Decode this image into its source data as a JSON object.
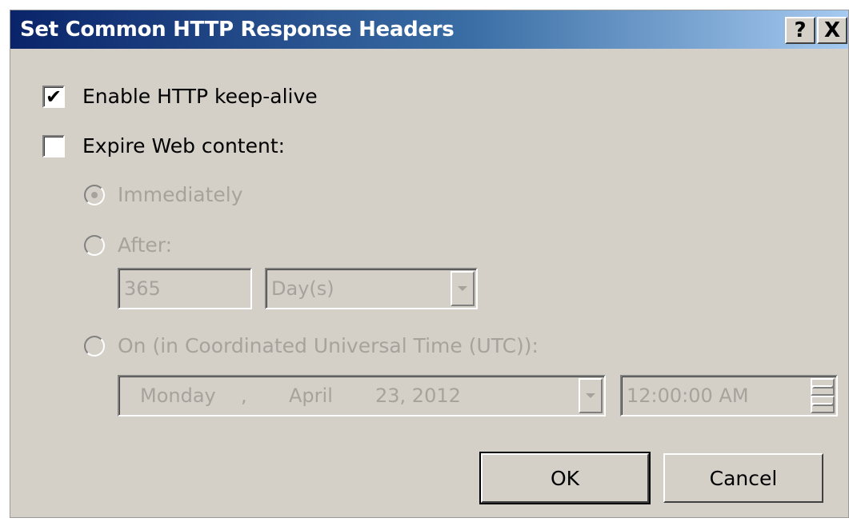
{
  "dialog": {
    "title": "Set Common HTTP Response Headers",
    "help_label": "?",
    "close_label": "X"
  },
  "keepalive": {
    "label": "Enable HTTP keep-alive",
    "checked": true,
    "check_mark": "✔"
  },
  "expire": {
    "label": "Expire Web content:",
    "checked": false
  },
  "immediately": {
    "label": "Immediately",
    "selected": true
  },
  "after": {
    "label": "After:",
    "value": "365",
    "unit": "Day(s)"
  },
  "on": {
    "label": "On (in Coordinated Universal Time (UTC)):",
    "weekday": "Monday",
    "sep": ",",
    "month": "April",
    "day_year": "23, 2012",
    "time": "12:00:00 AM"
  },
  "buttons": {
    "ok": "OK",
    "cancel": "Cancel"
  },
  "icons": {
    "help": "question-icon",
    "close": "close-icon",
    "dropdown": "chevron-down-icon",
    "spin_up": "chevron-up-icon",
    "spin_down": "chevron-down-icon"
  },
  "colors": {
    "title_start": "#0a246a",
    "title_end": "#a6caf0",
    "face": "#d4d0c8",
    "disabled_text": "#a7a39c"
  }
}
